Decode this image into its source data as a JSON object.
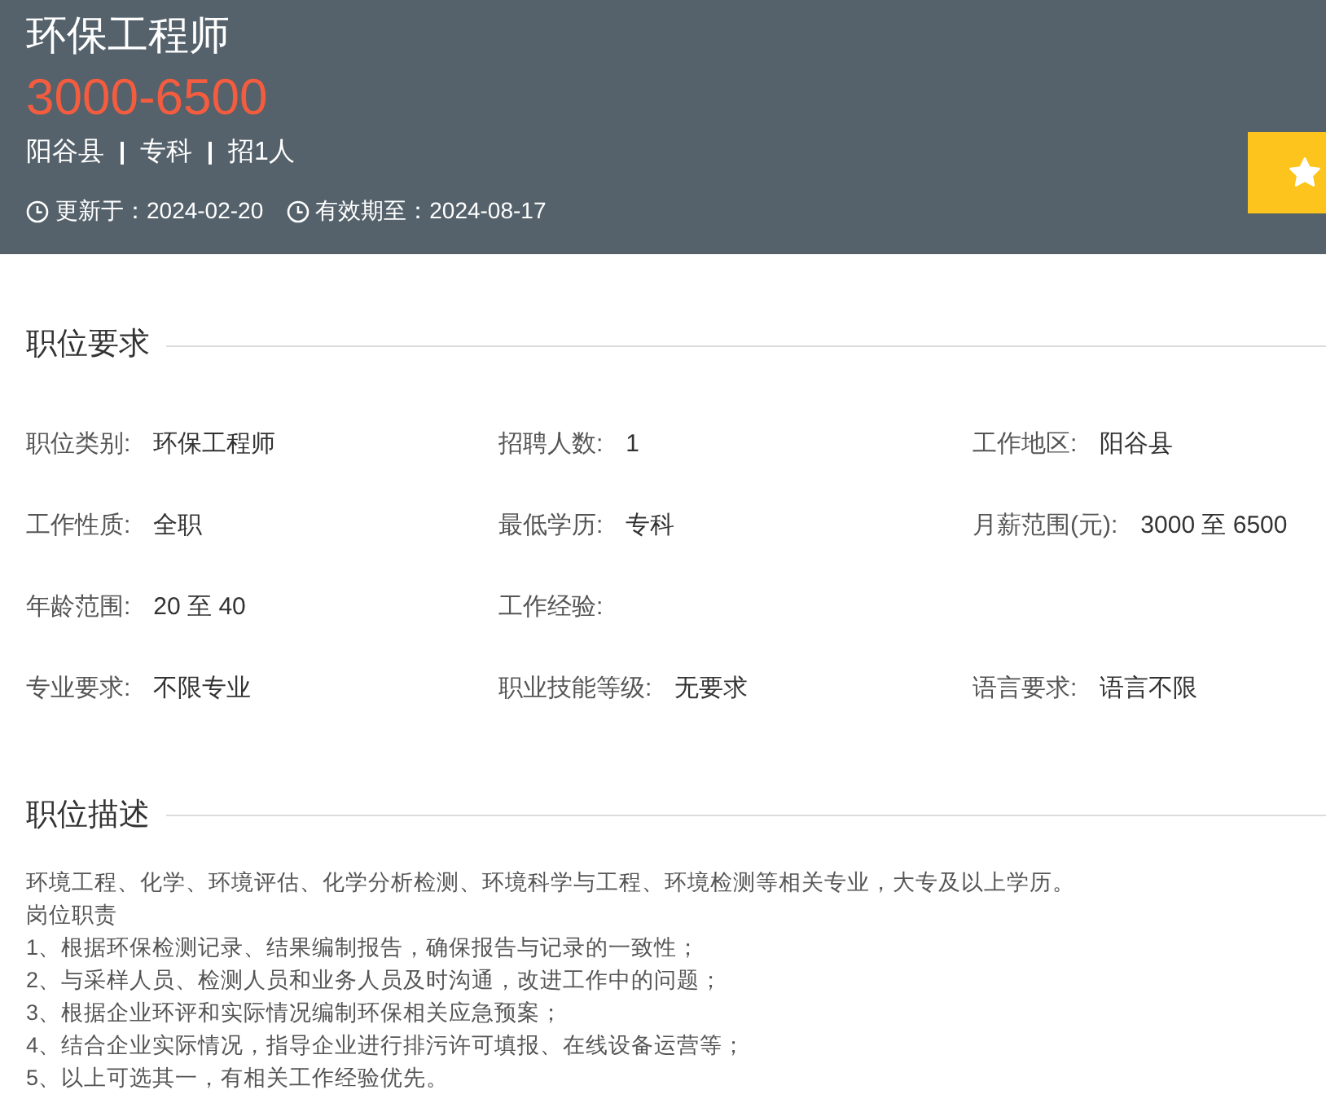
{
  "header": {
    "title": "环保工程师",
    "salary": "3000-6500",
    "meta": [
      "阳谷县",
      "专科",
      "招1人"
    ],
    "dates": [
      {
        "label": "更新于：2024-02-20"
      },
      {
        "label": "有效期至：2024-08-17"
      }
    ],
    "favorite": {
      "on": false
    }
  },
  "requirements": {
    "title": "职位要求",
    "rows": [
      [
        {
          "label": "职位类别:",
          "value": "环保工程师"
        },
        {
          "label": "招聘人数:",
          "value": "1"
        },
        {
          "label": "工作地区:",
          "value": "阳谷县"
        }
      ],
      [
        {
          "label": "工作性质:",
          "value": "全职"
        },
        {
          "label": "最低学历:",
          "value": "专科"
        },
        {
          "label": "月薪范围(元):",
          "value": "3000 至 6500"
        }
      ],
      [
        {
          "label": "年龄范围:",
          "value": "20 至 40"
        },
        {
          "label": "工作经验:"
        }
      ],
      [
        {
          "label": "专业要求:",
          "value": "不限专业"
        },
        {
          "label": "职业技能等级:",
          "value": "无要求"
        },
        {
          "label": "语言要求:",
          "value": "语言不限"
        }
      ]
    ]
  },
  "description": {
    "title": "职位描述",
    "lines": [
      "环境工程、化学、环境评估、化学分析检测、环境科学与工程、环境检测等相关专业，大专及以上学历。",
      "岗位职责",
      "1、根据环保检测记录、结果编制报告，确保报告与记录的一致性；",
      "2、与采样人员、检测人员和业务人员及时沟通，改进工作中的问题；",
      "3、根据企业环评和实际情况编制环保相关应急预案；",
      "4、结合企业实际情况，指导企业进行排污许可填报、在线设备运营等；",
      "5、以上可选其一，有相关工作经验优先。"
    ]
  }
}
